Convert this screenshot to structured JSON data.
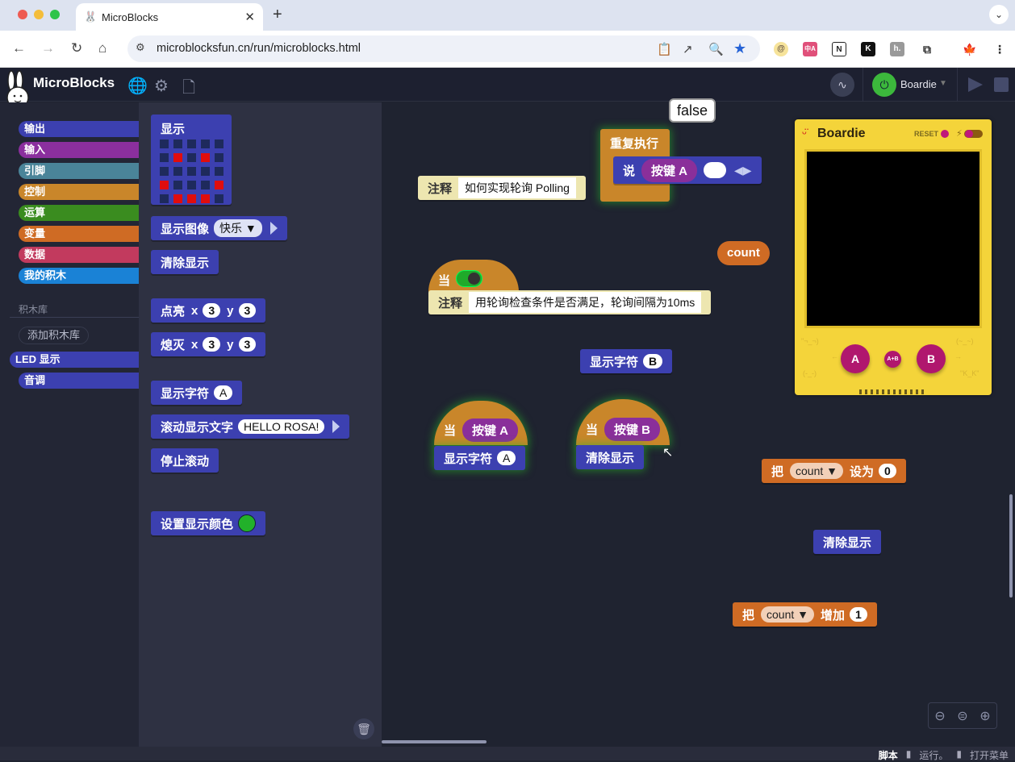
{
  "browser": {
    "tab_title": "MicroBlocks",
    "new_tab": "+",
    "url": "microblocksfun.cn/run/microblocks.html",
    "extensions": [
      "@",
      "中A",
      "N",
      "K",
      "h.",
      "puzzle",
      "leaf"
    ]
  },
  "app": {
    "title": "MicroBlocks",
    "board_name": "Boardie"
  },
  "categories": [
    {
      "label": "输出",
      "color": "#3c40b0"
    },
    {
      "label": "输入",
      "color": "#8b2f9e"
    },
    {
      "label": "引脚",
      "color": "#4a8499"
    },
    {
      "label": "控制",
      "color": "#c9862a"
    },
    {
      "label": "运算",
      "color": "#3a8c1f"
    },
    {
      "label": "变量",
      "color": "#cf6b24"
    },
    {
      "label": "数据",
      "color": "#c23a5e"
    },
    {
      "label": "我的积木",
      "color": "#1a82d6"
    }
  ],
  "library": {
    "header": "积木库",
    "add_button": "添加积木库",
    "items": [
      {
        "label": "LED 显示",
        "selected": true
      },
      {
        "label": "音调",
        "selected": false
      }
    ]
  },
  "palette": {
    "display_block": "显示",
    "led_on": [
      [
        1,
        1
      ],
      [
        1,
        3
      ],
      [
        3,
        0
      ],
      [
        3,
        4
      ],
      [
        4,
        1
      ],
      [
        4,
        2
      ],
      [
        4,
        3
      ]
    ],
    "show_image": "显示图像",
    "image_option": "快乐 ▼",
    "clear_display": "清除显示",
    "plot": "点亮",
    "unplot": "熄灭",
    "x_label": "x",
    "y_label": "y",
    "x_value": "3",
    "y_value": "3",
    "display_character": "显示字符",
    "character_value": "A",
    "scroll_text": "滚动显示文字",
    "scroll_value": "HELLO ROSA!",
    "stop_scroll": "停止滚动",
    "set_color": "设置显示颜色",
    "color_value": "#22b12a"
  },
  "workspace": {
    "bubble": "false",
    "forever": "重复执行",
    "say": "说",
    "button_a": "按键 A",
    "button_b": "按键 B",
    "comment_label": "注释",
    "comment1": "如何实现轮询 Polling",
    "comment2": "用轮询检查条件是否满足，轮询间隔为10ms",
    "when": "当",
    "display_character": "显示字符",
    "char_a": "A",
    "char_b": "B",
    "clear_display": "清除显示",
    "var_name": "count",
    "set_label": "把",
    "set_to": "设为",
    "set_value": "0",
    "change_label": "增加",
    "change_value": "1",
    "var_reporter": "count"
  },
  "boardie": {
    "title": "Boardie",
    "reset": "RESET",
    "button_a": "A",
    "button_b": "B",
    "button_ab": "A+B"
  },
  "status": {
    "scripts": "脚本",
    "run": "运行。",
    "menu": "打开菜单"
  }
}
